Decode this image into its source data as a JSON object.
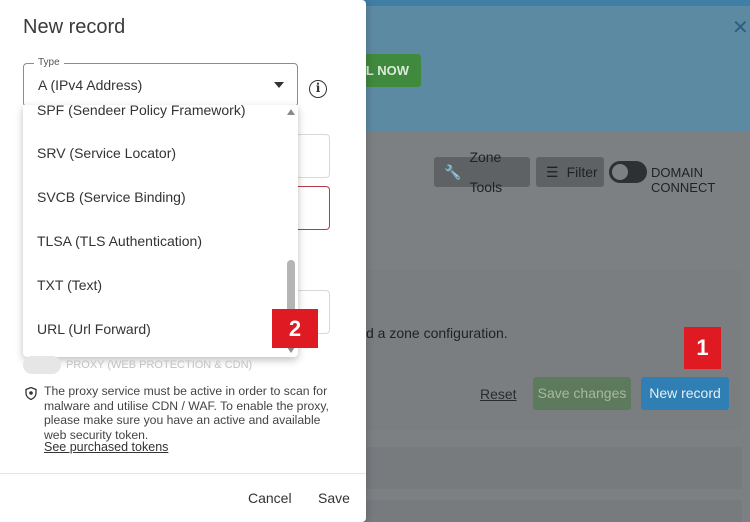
{
  "modal": {
    "title": "New record",
    "type_field": {
      "legend": "Type",
      "value": "A (IPv4 Address)"
    },
    "dropdown": {
      "partial_item": "SPF (Sendeer Policy Framework)",
      "items": [
        "SRV (Service Locator)",
        "SVCB (Service Binding)",
        "TLSA (TLS Authentication)",
        "TXT (Text)",
        "URL (Url Forward)"
      ]
    },
    "proxy": {
      "label": "PROXY (WEB PROTECTION & CDN)",
      "note": "The proxy service must be active in order to scan for malware and utilise CDN / WAF. To enable the proxy, please make sure you have an active and available web security token.",
      "link": "See purchased tokens"
    },
    "footer": {
      "cancel": "Cancel",
      "save": "Save"
    }
  },
  "background": {
    "banner_button": "AL NOW",
    "zone_tools": "Zone Tools",
    "filter": "Filter",
    "domain_connect": "DOMAIN CONNECT",
    "card_text": "d a zone configuration.",
    "reset": "Reset",
    "save_changes": "Save changes",
    "new_record": "New record"
  },
  "markers": {
    "one": "1",
    "two": "2"
  },
  "colors": {
    "marker_red": "#e01a22",
    "invalid_field_border": "#b23b4b",
    "primary_blue": "#2f7fb4",
    "save_green": "#5d7b5c"
  },
  "icons": [
    "wrench-icon",
    "filter-icon",
    "info-icon",
    "shield-icon",
    "close-icon",
    "chevron-down-icon"
  ]
}
